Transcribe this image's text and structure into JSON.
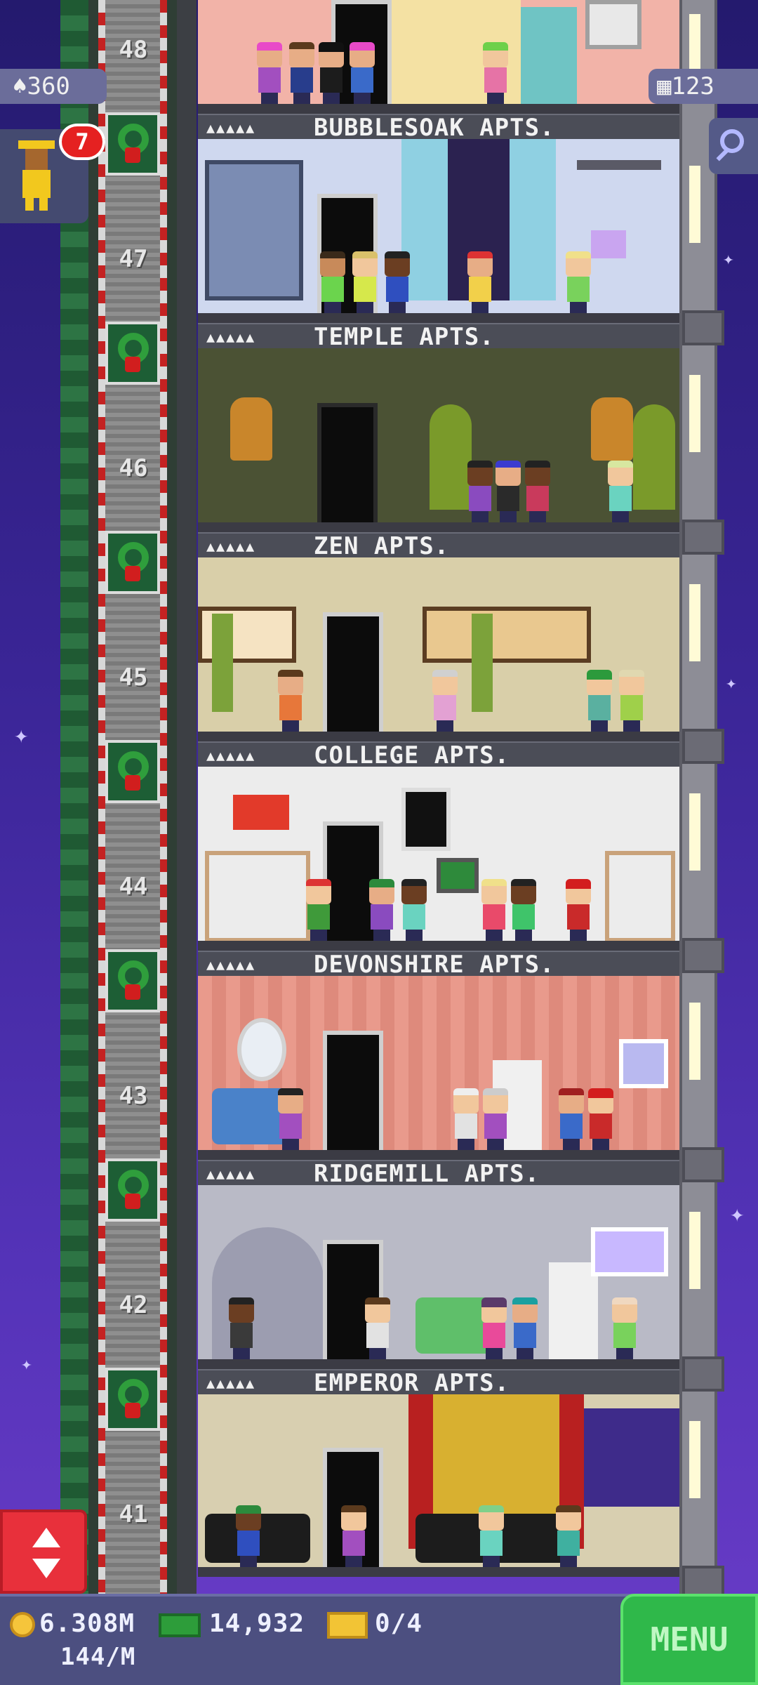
{
  "hud": {
    "population": "360",
    "floors": "123",
    "vip_count": "7",
    "coins": "6.308M",
    "coin_rate": "144/M",
    "bux": "14,932",
    "tickets": "0/4",
    "menu_label": "MENU"
  },
  "icons": {
    "population": "person-icon",
    "floors": "building-icon",
    "search": "search-icon",
    "elevator": "elevator-arrows-icon",
    "coin": "coin-icon",
    "bux": "bux-icon",
    "ticket": "golden-ticket-icon"
  },
  "colors": {
    "menu": "#2fb84a",
    "elevator_button": "#e8303b",
    "badge": "#e52121"
  },
  "floor_numbers": [
    "48",
    "47",
    "46",
    "45",
    "44",
    "43",
    "42",
    "41"
  ],
  "floors": [
    {
      "name": "BUBBLESOAK APTS.",
      "stars": "▲▲▲▲▲"
    },
    {
      "name": "TEMPLE APTS.",
      "stars": "▲▲▲▲▲"
    },
    {
      "name": "ZEN APTS.",
      "stars": "▲▲▲▲▲"
    },
    {
      "name": "COLLEGE APTS.",
      "stars": "▲▲▲▲▲"
    },
    {
      "name": "DEVONSHIRE APTS.",
      "stars": "▲▲▲▲▲"
    },
    {
      "name": "RIDGEMILL APTS.",
      "stars": "▲▲▲▲▲"
    },
    {
      "name": "EMPEROR APTS.",
      "stars": "▲▲▲▲▲"
    }
  ]
}
